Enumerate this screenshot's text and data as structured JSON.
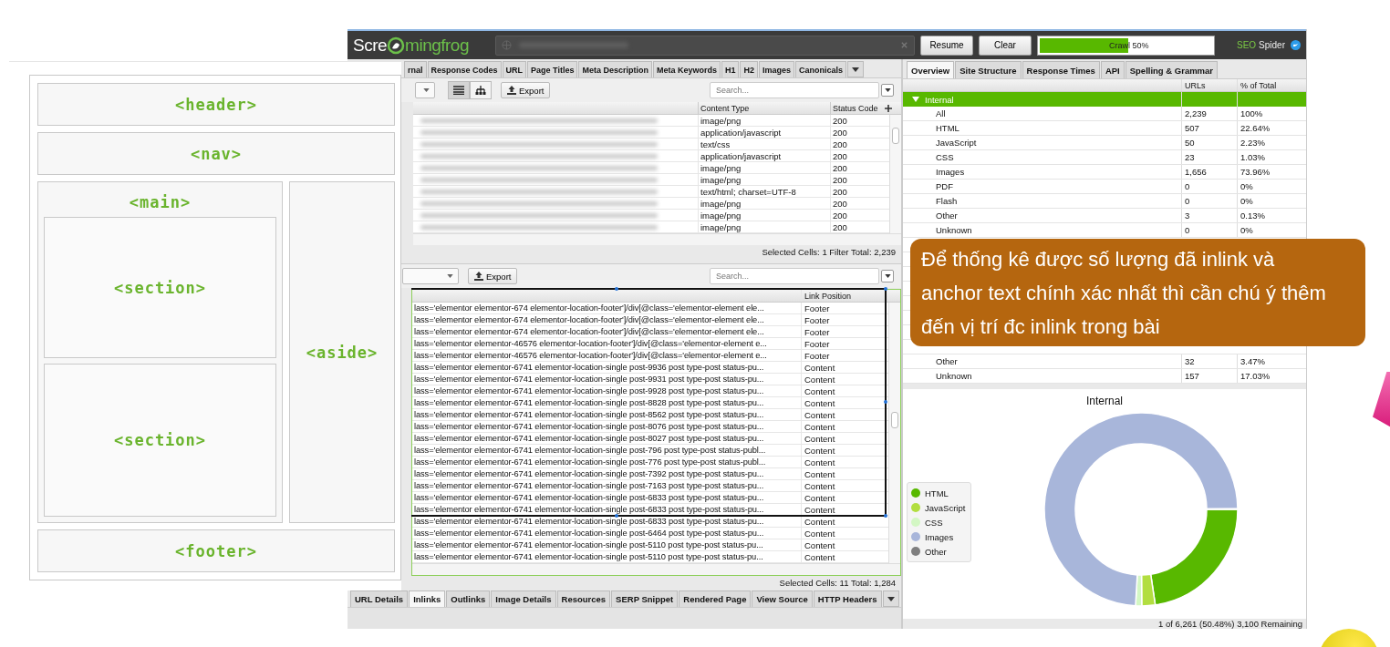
{
  "wireframe": {
    "header": "<header>",
    "nav": "<nav>",
    "main": "<main>",
    "sections": [
      "<section>",
      "<section>"
    ],
    "aside": "<aside>",
    "footer": "<footer>"
  },
  "topbar": {
    "logo_left": "Scre",
    "logo_right": "mingfrog",
    "buttons": [
      "Resume",
      "Clear"
    ],
    "progress": {
      "label": "Crawl 50%",
      "level": 0.5
    },
    "brand_accent": "SEO",
    "brand": "Spider"
  },
  "upper": {
    "tabs": [
      "rnal",
      "Response Codes",
      "URL",
      "Page Titles",
      "Meta Description",
      "Meta Keywords",
      "H1",
      "H2",
      "Images",
      "Canonicals"
    ],
    "export": "Export",
    "search": {
      "placeholder": "Search..."
    },
    "columns": [
      "Content Type",
      "Status Code"
    ],
    "rows": [
      [
        "image/png",
        "200"
      ],
      [
        "application/javascript",
        "200"
      ],
      [
        "text/css",
        "200"
      ],
      [
        "application/javascript",
        "200"
      ],
      [
        "image/png",
        "200"
      ],
      [
        "image/png",
        "200"
      ],
      [
        "text/html; charset=UTF-8",
        "200"
      ],
      [
        "image/png",
        "200"
      ],
      [
        "image/png",
        "200"
      ],
      [
        "image/png",
        "200"
      ]
    ],
    "status": "Selected Cells: 1  Filter Total: 2,239"
  },
  "lower": {
    "export": "Export",
    "search": {
      "placeholder": "Search..."
    },
    "columns": [
      "",
      "Link Position"
    ],
    "rows": [
      [
        "lass='elementor elementor-674 elementor-location-footer']/div[@class='elementor-element ele...",
        "Footer"
      ],
      [
        "lass='elementor elementor-674 elementor-location-footer']/div[@class='elementor-element ele...",
        "Footer"
      ],
      [
        "lass='elementor elementor-674 elementor-location-footer']/div[@class='elementor-element ele...",
        "Footer"
      ],
      [
        "lass='elementor elementor-46576 elementor-location-footer']/div[@class='elementor-element e...",
        "Footer"
      ],
      [
        "lass='elementor elementor-46576 elementor-location-footer']/div[@class='elementor-element e...",
        "Footer"
      ],
      [
        "lass='elementor elementor-6741 elementor-location-single post-9936 post type-post status-pu...",
        "Content"
      ],
      [
        "lass='elementor elementor-6741 elementor-location-single post-9931 post type-post status-pu...",
        "Content"
      ],
      [
        "lass='elementor elementor-6741 elementor-location-single post-9928 post type-post status-pu...",
        "Content"
      ],
      [
        "lass='elementor elementor-6741 elementor-location-single post-8828 post type-post status-pu...",
        "Content"
      ],
      [
        "lass='elementor elementor-6741 elementor-location-single post-8562 post type-post status-pu...",
        "Content"
      ],
      [
        "lass='elementor elementor-6741 elementor-location-single post-8076 post type-post status-pu...",
        "Content"
      ],
      [
        "lass='elementor elementor-6741 elementor-location-single post-8027 post type-post status-pu...",
        "Content"
      ],
      [
        "lass='elementor elementor-6741 elementor-location-single post-796 post type-post status-publ...",
        "Content"
      ],
      [
        "lass='elementor elementor-6741 elementor-location-single post-776 post type-post status-publ...",
        "Content"
      ],
      [
        "lass='elementor elementor-6741 elementor-location-single post-7392 post type-post status-pu...",
        "Content"
      ],
      [
        "lass='elementor elementor-6741 elementor-location-single post-7163 post type-post status-pu...",
        "Content"
      ],
      [
        "lass='elementor elementor-6741 elementor-location-single post-6833 post type-post status-pu...",
        "Content"
      ],
      [
        "lass='elementor elementor-6741 elementor-location-single post-6833 post type-post status-pu...",
        "Content"
      ],
      [
        "lass='elementor elementor-6741 elementor-location-single post-6833 post type-post status-pu...",
        "Content"
      ],
      [
        "lass='elementor elementor-6741 elementor-location-single post-6464 post type-post status-pu...",
        "Content"
      ],
      [
        "lass='elementor elementor-6741 elementor-location-single post-5110 post type-post status-pu...",
        "Content"
      ],
      [
        "lass='elementor elementor-6741 elementor-location-single post-5110 post type-post status-pu...",
        "Content"
      ]
    ],
    "status": "Selected Cells: 11  Total: 1,284",
    "tabs": [
      {
        "label": "URL Details",
        "selected": false
      },
      {
        "label": "Inlinks",
        "selected": true
      },
      {
        "label": "Outlinks",
        "selected": false
      },
      {
        "label": "Image Details",
        "selected": false
      },
      {
        "label": "Resources",
        "selected": false
      },
      {
        "label": "SERP Snippet",
        "selected": false
      },
      {
        "label": "Rendered Page",
        "selected": false
      },
      {
        "label": "View Source",
        "selected": false
      },
      {
        "label": "HTTP Headers",
        "selected": false
      }
    ]
  },
  "right": {
    "tabs": [
      {
        "label": "Overview",
        "selected": true
      },
      {
        "label": "Site Structure",
        "selected": false
      },
      {
        "label": "Response Times",
        "selected": false
      },
      {
        "label": "API",
        "selected": false
      },
      {
        "label": "Spelling & Grammar",
        "selected": false
      }
    ],
    "columns": [
      "",
      "URLs",
      "% of Total"
    ],
    "group": {
      "label": "Internal",
      "expanded": true
    },
    "rows": [
      [
        "All",
        "2,239",
        "100%"
      ],
      [
        "HTML",
        "507",
        "22.64%"
      ],
      [
        "JavaScript",
        "50",
        "2.23%"
      ],
      [
        "CSS",
        "23",
        "1.03%"
      ],
      [
        "Images",
        "1,656",
        "73.96%"
      ],
      [
        "PDF",
        "0",
        "0%"
      ],
      [
        "Flash",
        "0",
        "0%"
      ],
      [
        "Other",
        "3",
        "0.13%"
      ],
      [
        "Unknown",
        "0",
        "0%"
      ]
    ],
    "rows_below": [
      [
        "Other",
        "32",
        "3.47%"
      ],
      [
        "Unknown",
        "157",
        "17.03%"
      ]
    ],
    "chart": {
      "legend": [
        {
          "color": "#58b800"
        },
        {
          "color": "#b2de40"
        },
        {
          "color": "#d3f7c4"
        },
        {
          "color": "#a8b6da"
        },
        {
          "color": "#7f7f7f"
        }
      ],
      "chart_data": {
        "type": "donut",
        "title": "Internal",
        "categories": [
          "HTML",
          "JavaScript",
          "CSS",
          "Images",
          "Other"
        ],
        "values": [
          22.64,
          2.23,
          1.03,
          73.96,
          0.13
        ]
      }
    },
    "status": "1 of 6,261 (50.48%) 3,100 Remaining"
  },
  "callout": "Để thống kê được số lượng đã inlink và anchor text chính xác nhất thì cần chú ý thêm đến vị trí đc inlink trong bài"
}
